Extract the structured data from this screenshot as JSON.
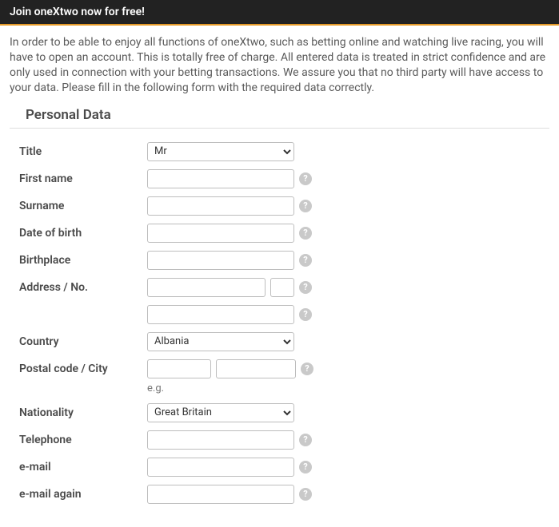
{
  "header": {
    "title": "Join oneXtwo now for free!"
  },
  "intro": "In order to be able to enjoy all functions of oneXtwo, such as betting online and watching live racing, you will have to open an account. This is totally free of charge. All entered data is treated in strict confidence and are only used in connection with your betting transactions. We assure you that no third party will have access to your data. Please fill in the following form with the required data correctly.",
  "section": {
    "title": "Personal Data"
  },
  "fields": {
    "title_label": "Title",
    "title_value": "Mr",
    "first_name_label": "First name",
    "surname_label": "Surname",
    "dob_label": "Date of birth",
    "birthplace_label": "Birthplace",
    "address_label": "Address / No.",
    "country_label": "Country",
    "country_value": "Albania",
    "postal_label": "Postal code / City",
    "postal_hint": "e.g.",
    "nationality_label": "Nationality",
    "nationality_value": "Great Britain",
    "telephone_label": "Telephone",
    "email_label": "e-mail",
    "email2_label": "e-mail again"
  },
  "help_glyph": "?"
}
